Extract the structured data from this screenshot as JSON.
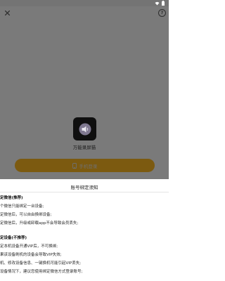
{
  "modal": {
    "help_label": "?",
    "app_name": "万能录屏猫",
    "bind_label": "手机登录"
  },
  "sheet": {
    "title": "账号绑定须知",
    "section1_title": "定微信(推荐)",
    "section1_lines": [
      "个微信只能绑定一台设备;",
      "定微信后，可以自由换绑设备;",
      "定微信后，升级或卸载app不会导致会员丢失;"
    ],
    "section2_title": "定设备(不推荐)",
    "section2_lines": [
      "定本机设备开通VIP后，不可换绑;",
      "果该设备刷机的设备会导致VIP失效;",
      "机、修改设备信息、一键换机可能引起VIP丢失;",
      "设备情况下，建议您使用绑定微信方式登录账号;"
    ]
  },
  "colors": {
    "overlay": "#7a7a7a",
    "accent_dimmed": "#7c5a10",
    "app_icon_bg": "#0f0f0f"
  },
  "icons": [
    "wifi-icon",
    "battery-icon",
    "close-icon",
    "help-icon",
    "speaker-icon",
    "phone-icon"
  ]
}
